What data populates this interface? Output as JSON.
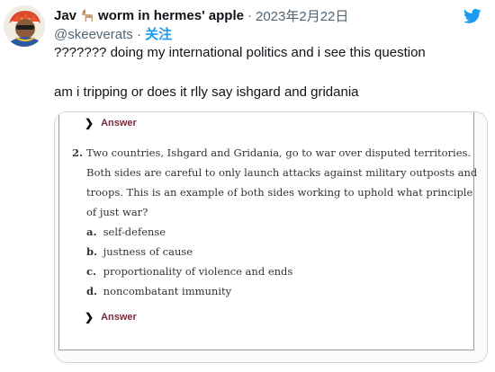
{
  "tweet": {
    "display_name": "Jav",
    "name_suffix": "worm in hermes' apple",
    "date": "2023年2月22日",
    "handle": "@skeeverats",
    "follow_label": "关注",
    "separator": "·",
    "line1": "??????? doing my international politics and i see this question",
    "line2": "am i tripping or does it rlly say ishgard and gridania"
  },
  "media": {
    "answer_label": "Answer",
    "question_number": "2.",
    "question_lines": [
      "Two countries, Ishgard and Gridania, go to war over disputed territories.",
      "Both sides are careful to only launch attacks against military outposts and",
      "troops. This is an example of both sides working to uphold what principle",
      "of just war?"
    ],
    "options": [
      {
        "letter": "a.",
        "text": "self-defense"
      },
      {
        "letter": "b.",
        "text": "justness of cause"
      },
      {
        "letter": "c.",
        "text": "proportionality of violence and ends"
      },
      {
        "letter": "d.",
        "text": "noncombatant immunity"
      }
    ]
  },
  "icons": {
    "twitter": "twitter-bird-icon",
    "llama": "llama-emoji-icon",
    "chevron": "chevron-right-icon"
  },
  "colors": {
    "twitter_blue": "#1d9bf0",
    "answer_color": "#7b2a3a",
    "meta_gray": "#536471"
  }
}
